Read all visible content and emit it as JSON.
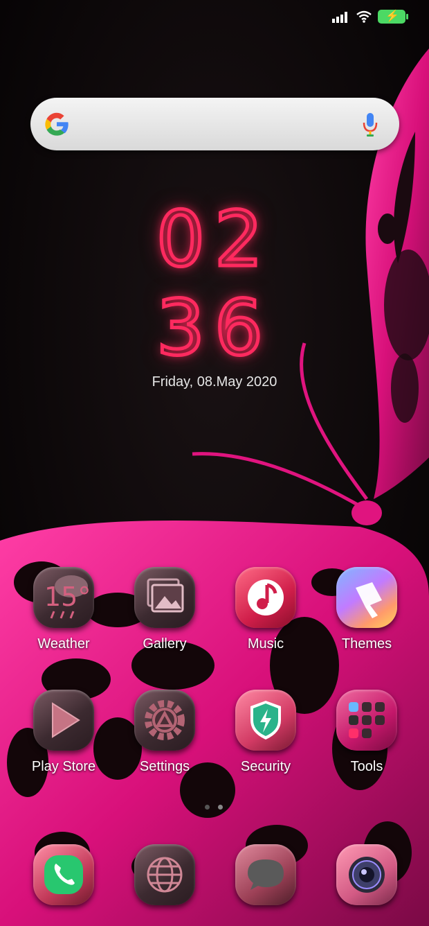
{
  "status_bar": {
    "signal_icon": "signal-bars-icon",
    "wifi_icon": "wifi-icon",
    "battery_icon": "battery-charging-icon"
  },
  "search": {
    "icon": "google-g-icon",
    "mic_icon": "mic-icon"
  },
  "clock": {
    "hours": "02",
    "minutes": "36",
    "date": "Friday, 08.May 2020"
  },
  "apps": [
    {
      "label": "Weather",
      "icon": "weather-icon",
      "badge": "15°"
    },
    {
      "label": "Gallery",
      "icon": "gallery-icon"
    },
    {
      "label": "Music",
      "icon": "music-icon"
    },
    {
      "label": "Themes",
      "icon": "themes-icon"
    },
    {
      "label": "Play Store",
      "icon": "play-store-icon"
    },
    {
      "label": "Settings",
      "icon": "settings-icon"
    },
    {
      "label": "Security",
      "icon": "security-icon"
    },
    {
      "label": "Tools",
      "icon": "tools-folder-icon"
    }
  ],
  "page_indicator": {
    "pages": 2,
    "current": 2
  },
  "dock": [
    {
      "icon": "phone-icon"
    },
    {
      "icon": "browser-icon"
    },
    {
      "icon": "messages-icon"
    },
    {
      "icon": "camera-icon"
    }
  ],
  "colors": {
    "accent": "#ff2a5f",
    "wallpaper_pink": "#e0147f",
    "battery": "#4cd964"
  }
}
